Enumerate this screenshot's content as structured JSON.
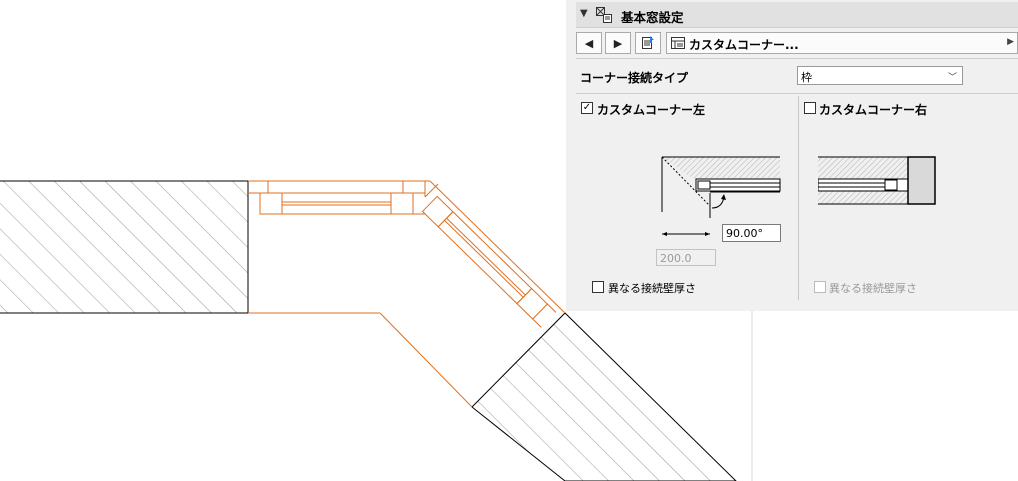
{
  "panel": {
    "title": "基本窓設定",
    "toolbar": {
      "prev_icon": "chevron-left-icon",
      "next_icon": "chevron-right-icon",
      "settings_icon": "document-settings-icon",
      "component_name": "カスタムコーナー..."
    },
    "corner_type_label": "コーナー接続タイプ",
    "corner_type_value": "枠",
    "left": {
      "label": "カスタムコーナー左",
      "checked": true,
      "angle": "90.00°",
      "length": "200.0",
      "diff_thickness_label": "異なる接続壁厚さ"
    },
    "right": {
      "label": "カスタムコーナー右",
      "checked": false,
      "diff_thickness_label": "異なる接続壁厚さ"
    }
  },
  "colors": {
    "window_orange": "#e07020",
    "panel_bg": "#f0f0f0",
    "header_bg": "#e1e1e1"
  }
}
